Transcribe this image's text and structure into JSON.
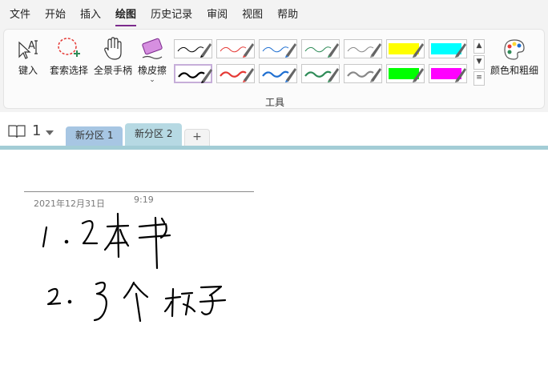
{
  "menu": {
    "items": [
      {
        "label": "文件"
      },
      {
        "label": "开始"
      },
      {
        "label": "插入"
      },
      {
        "label": "绘图",
        "active": true
      },
      {
        "label": "历史记录"
      },
      {
        "label": "审阅"
      },
      {
        "label": "视图"
      },
      {
        "label": "帮助"
      }
    ]
  },
  "ribbon": {
    "type_label": "键入",
    "lasso_label": "套索选择",
    "pan_label": "全景手柄",
    "eraser_label": "橡皮擦",
    "color_label": "颜色和粗细",
    "group_label": "工具",
    "pens": [
      {
        "color": "#000000",
        "kind": "pen-thin"
      },
      {
        "color": "#e53935",
        "kind": "pen-thin"
      },
      {
        "color": "#1f6fd1",
        "kind": "pen-thin"
      },
      {
        "color": "#2e8b57",
        "kind": "pen-thin"
      },
      {
        "color": "#888888",
        "kind": "pen-thin"
      },
      {
        "color": "#ffff00",
        "kind": "highlighter"
      },
      {
        "color": "#00ffff",
        "kind": "highlighter"
      },
      {
        "color": "#000000",
        "kind": "pen-thick",
        "selected": true
      },
      {
        "color": "#e53935",
        "kind": "pen-thick"
      },
      {
        "color": "#1f6fd1",
        "kind": "pen-thick"
      },
      {
        "color": "#2e8b57",
        "kind": "pen-thick"
      },
      {
        "color": "#888888",
        "kind": "pen-thick"
      },
      {
        "color": "#00ff00",
        "kind": "highlighter"
      },
      {
        "color": "#ff00ff",
        "kind": "highlighter"
      }
    ]
  },
  "notebook": {
    "number": "1",
    "sections": [
      {
        "label": "新分区 1"
      },
      {
        "label": "新分区 2",
        "active": true
      }
    ],
    "add_label": "+"
  },
  "page": {
    "date": "2021年12月31日",
    "time": "9:19"
  },
  "colors": {
    "accent": "#7b2a8c",
    "section1": "#a7c6e3",
    "section2": "#b6d9e3",
    "divider": "#a3cdd6"
  }
}
